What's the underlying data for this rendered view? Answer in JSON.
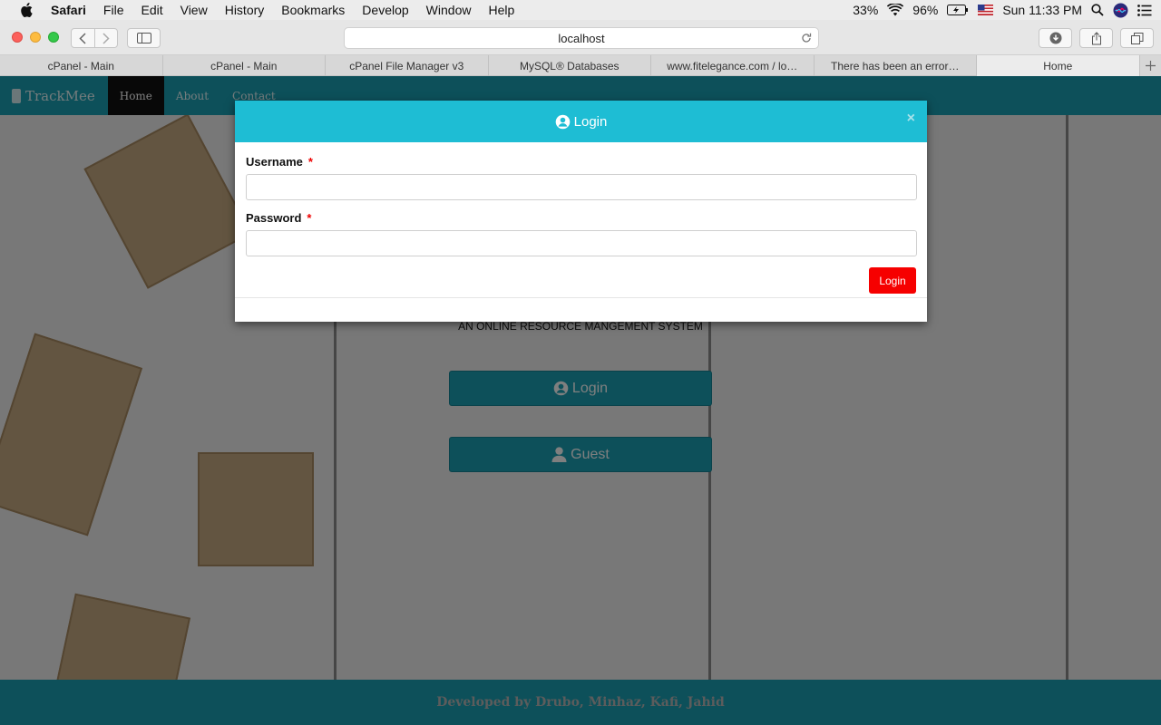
{
  "menubar": {
    "app": "Safari",
    "items": [
      "File",
      "Edit",
      "View",
      "History",
      "Bookmarks",
      "Develop",
      "Window",
      "Help"
    ],
    "cpu": "33%",
    "battery": "96%",
    "clock": "Sun 11:33 PM"
  },
  "browser": {
    "url": "localhost",
    "tabs": [
      {
        "label": "cPanel - Main"
      },
      {
        "label": "cPanel - Main"
      },
      {
        "label": "cPanel File Manager v3"
      },
      {
        "label": "MySQL® Databases"
      },
      {
        "label": "www.fitelegance.com / lo…"
      },
      {
        "label": "There has been an error…"
      },
      {
        "label": "Home"
      }
    ]
  },
  "site": {
    "brand": "TrackMee",
    "nav": [
      "Home",
      "About",
      "Contact"
    ],
    "subtitle": "AN ONLINE RESOURCE MANGEMENT SYSTEM",
    "login_button": "Login",
    "guest_button": "Guest",
    "footer": "Developed by Drubo, Minhaz, Kafi, Jahid",
    "accent": "#1aa1b4"
  },
  "modal": {
    "title": "Login",
    "close": "×",
    "username_label": "Username",
    "password_label": "Password",
    "required_mark": "*",
    "submit": "Login",
    "header_color": "#1ebdd4",
    "submit_color": "#f60000"
  }
}
